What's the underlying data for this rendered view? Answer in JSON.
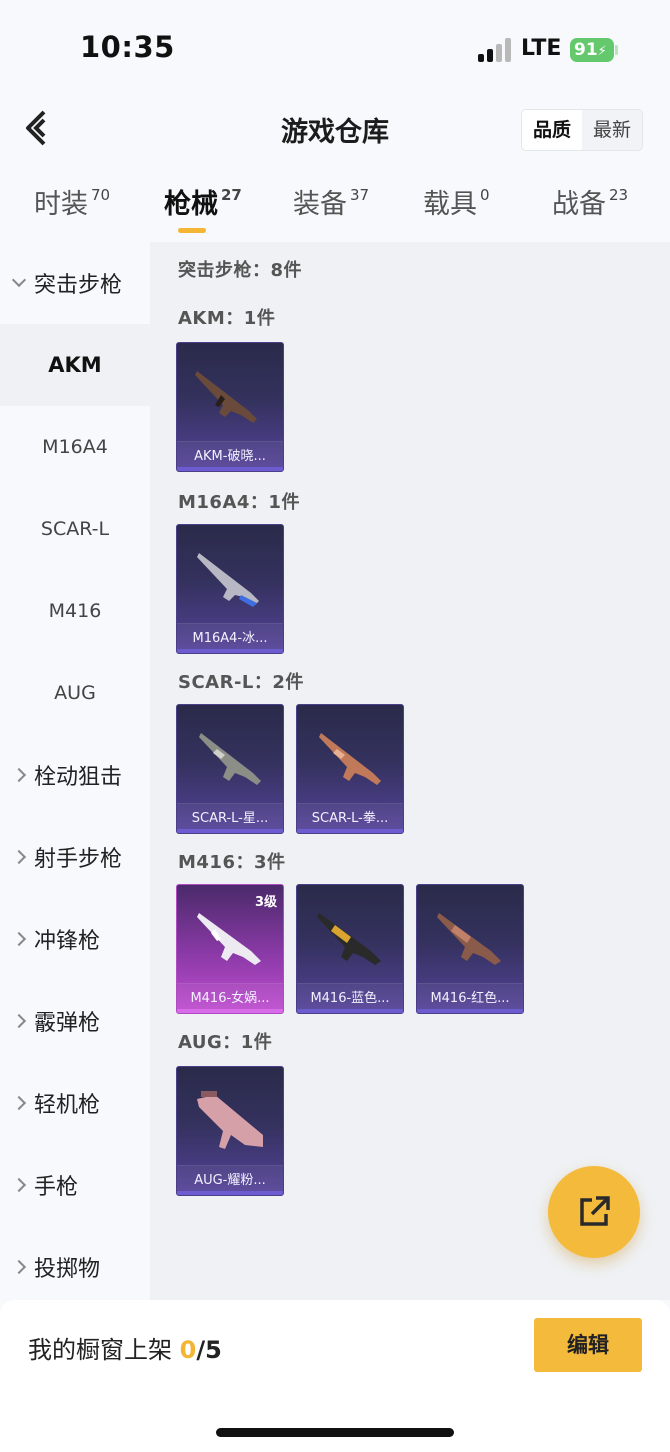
{
  "status": {
    "time": "10:35",
    "network": "LTE",
    "battery": "91"
  },
  "header": {
    "title": "游戏仓库",
    "sort": [
      "品质",
      "最新"
    ],
    "sort_active": 0
  },
  "tabs": [
    {
      "label": "时装",
      "count": "70"
    },
    {
      "label": "枪械",
      "count": "27"
    },
    {
      "label": "装备",
      "count": "37"
    },
    {
      "label": "载具",
      "count": "0"
    },
    {
      "label": "战备",
      "count": "23"
    }
  ],
  "sidebar": {
    "group_open": "突击步枪",
    "subs": [
      "AKM",
      "M16A4",
      "SCAR-L",
      "M416",
      "AUG"
    ],
    "active_sub": "AKM",
    "groups": [
      "栓动狙击",
      "射手步枪",
      "冲锋枪",
      "霰弹枪",
      "轻机枪",
      "手枪",
      "投掷物"
    ]
  },
  "main": {
    "summary": "突击步枪：8件",
    "sections": [
      {
        "label": "AKM：1件",
        "items": [
          {
            "name": "AKM-破晓...",
            "icon": "akm-rifle-icon"
          }
        ]
      },
      {
        "label": "M16A4：1件",
        "items": [
          {
            "name": "M16A4-冰...",
            "icon": "m16a4-rifle-icon"
          }
        ]
      },
      {
        "label": "SCAR-L：2件",
        "items": [
          {
            "name": "SCAR-L-星...",
            "icon": "scar-rifle-icon"
          },
          {
            "name": "SCAR-L-拳...",
            "icon": "scar-rifle-icon"
          }
        ]
      },
      {
        "label": "M416：3件",
        "items": [
          {
            "name": "M416-女娲...",
            "level": "3级",
            "icon": "m416-rifle-icon"
          },
          {
            "name": "M416-蓝色...",
            "icon": "m416-rifle-icon"
          },
          {
            "name": "M416-红色...",
            "icon": "m416-rifle-icon"
          }
        ]
      },
      {
        "label": "AUG：1件",
        "items": [
          {
            "name": "AUG-耀粉...",
            "icon": "aug-rifle-icon"
          }
        ]
      }
    ]
  },
  "bottom": {
    "shelf_label": "我的橱窗上架 ",
    "shelf_current": "0",
    "shelf_total": "/5",
    "edit_label": "编辑"
  },
  "colors": {
    "accent": "#f4ba3c",
    "card_blue": "#34325e",
    "card_pink": "#8c3aa8"
  }
}
